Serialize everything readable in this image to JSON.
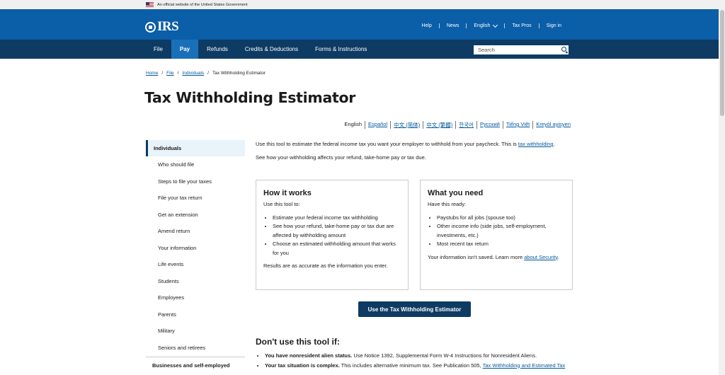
{
  "gov_banner": {
    "text": "An official website of the United States Government"
  },
  "header": {
    "logo_text": "IRS",
    "util_nav": [
      "Help",
      "News",
      "English",
      "Tax Pros",
      "Sign in"
    ]
  },
  "main_nav": {
    "items": [
      "File",
      "Pay",
      "Refunds",
      "Credits & Deductions",
      "Forms & Instructions"
    ],
    "active": "Pay",
    "search_placeholder": "Search"
  },
  "breadcrumb": [
    "Home",
    "File",
    "Individuals",
    "Tax Withholding Estimator"
  ],
  "page_title": "Tax Withholding Estimator",
  "languages": [
    "English",
    "Español",
    "中文 (简体)",
    "中文 (繁體)",
    "한국어",
    "Русский",
    "Tiếng Việt",
    "Kreyòl ayisyen"
  ],
  "sidebar": {
    "heading": "Individuals",
    "items": [
      "Who should file",
      "Steps to file your taxes",
      "File your tax return",
      "Get an extension",
      "Amend return",
      "Your information",
      "Life events",
      "Students",
      "Employees",
      "Parents",
      "Military",
      "Seniors and retirees"
    ],
    "footer": "Businesses and self-employed"
  },
  "content": {
    "intro_text": "Use this tool to estimate the federal income tax you want your employer to withhold from your paycheck. This is",
    "intro_link": "tax withholding",
    "intro_end": ".",
    "intro2": "See how your withholding affects your refund, take-home pay or tax due."
  },
  "how_it_works": {
    "title": "How it works",
    "lead": "Use this tool to:",
    "items": [
      "Estimate your federal income tax withholding",
      "See how your refund, take-home pay or tax due are affected by withholding amount",
      "Choose an estimated withholding amount that works for you"
    ],
    "footer": "Results are as accurate as the information you enter."
  },
  "what_you_need": {
    "title": "What you need",
    "lead": "Have this ready:",
    "items": [
      "Paystubs for all jobs (spouse too)",
      "Other income info (side jobs, self-employment, investments, etc.)",
      "Most recent tax return"
    ],
    "footer_text": "Your information isn't saved. Learn more",
    "footer_link": "about Security",
    "footer_end": "."
  },
  "cta_label": "Use the Tax Withholding Estimator",
  "dont_use": {
    "title": "Don't use this tool if:",
    "item1_bold": "You have nonresident alien status.",
    "item1_text": "Use Notice 1392, Supplemental Form W-4 Instructions for Nonresident Aliens.",
    "item2_bold": "Your tax situation is complex.",
    "item2_text": "This includes alternative minimum tax. See Publication 505,",
    "item2_link": "Tax Withholding and Estimated Tax"
  }
}
